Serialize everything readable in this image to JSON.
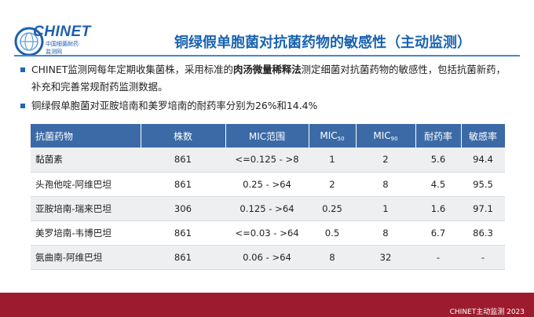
{
  "logo": {
    "text": "CHINET",
    "sub1": "中国细菌耐药",
    "sub2": "监测网"
  },
  "title": "铜绿假单胞菌对抗菌药物的敏感性（主动监测）",
  "bullets": {
    "b1_pre": "CHINET监测网每年定期收集菌株，采用标准的",
    "b1_bold": "肉汤微量稀释法",
    "b1_post": "测定细菌对抗菌药物的敏感性，包括抗菌新药，补充和完善常规耐药监测数据。",
    "b2": "铜绿假单胞菌对亚胺培南和美罗培南的耐药率分别为26%和14.4%"
  },
  "table": {
    "headers": {
      "drug": "抗菌药物",
      "count": "株数",
      "range": "MIC范围",
      "mic50_base": "MIC",
      "mic50_sub": "50",
      "mic90_base": "MIC",
      "mic90_sub": "90",
      "resistant": "耐药率",
      "susceptible": "敏感率"
    },
    "rows": [
      [
        "黏菌素",
        "861",
        "<=0.125 - >8",
        "1",
        "2",
        "5.6",
        "94.4"
      ],
      [
        "头孢他啶-阿维巴坦",
        "861",
        "0.25 - >64",
        "2",
        "8",
        "4.5",
        "95.5"
      ],
      [
        "亚胺培南-瑞来巴坦",
        "306",
        "0.125 - >64",
        "0.25",
        "1",
        "1.6",
        "97.1"
      ],
      [
        "美罗培南-韦博巴坦",
        "861",
        "<=0.03 - >64",
        "0.5",
        "8",
        "6.7",
        "86.3"
      ],
      [
        "氨曲南-阿维巴坦",
        "861",
        "0.06 - >64",
        "8",
        "32",
        "-",
        "-"
      ]
    ]
  },
  "footer": {
    "text": "CHINET主动监测 2023"
  },
  "colors": {
    "accent": "#1a63b0",
    "table_header": "#3b6aa6",
    "footer_bar": "#9d1b2e"
  }
}
